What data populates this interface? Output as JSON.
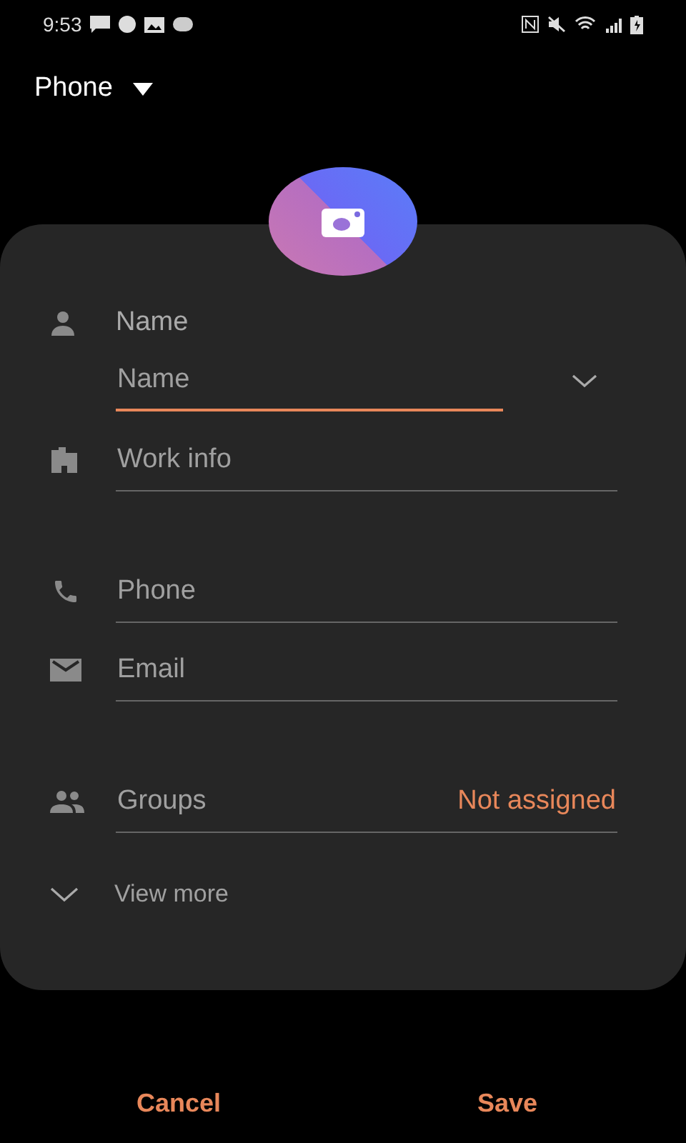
{
  "status_bar": {
    "time": "9:53"
  },
  "header": {
    "account": "Phone"
  },
  "form": {
    "name_label": "Name",
    "name_field": {
      "placeholder": "Name",
      "focused": true
    },
    "fields": [
      {
        "kind": "work",
        "placeholder": "Work info"
      },
      {
        "kind": "phone",
        "placeholder": "Phone"
      },
      {
        "kind": "email",
        "placeholder": "Email"
      }
    ],
    "groups": {
      "label": "Groups",
      "value": "Not assigned"
    },
    "view_more": "View more"
  },
  "buttons": [
    "Cancel",
    "Save"
  ]
}
